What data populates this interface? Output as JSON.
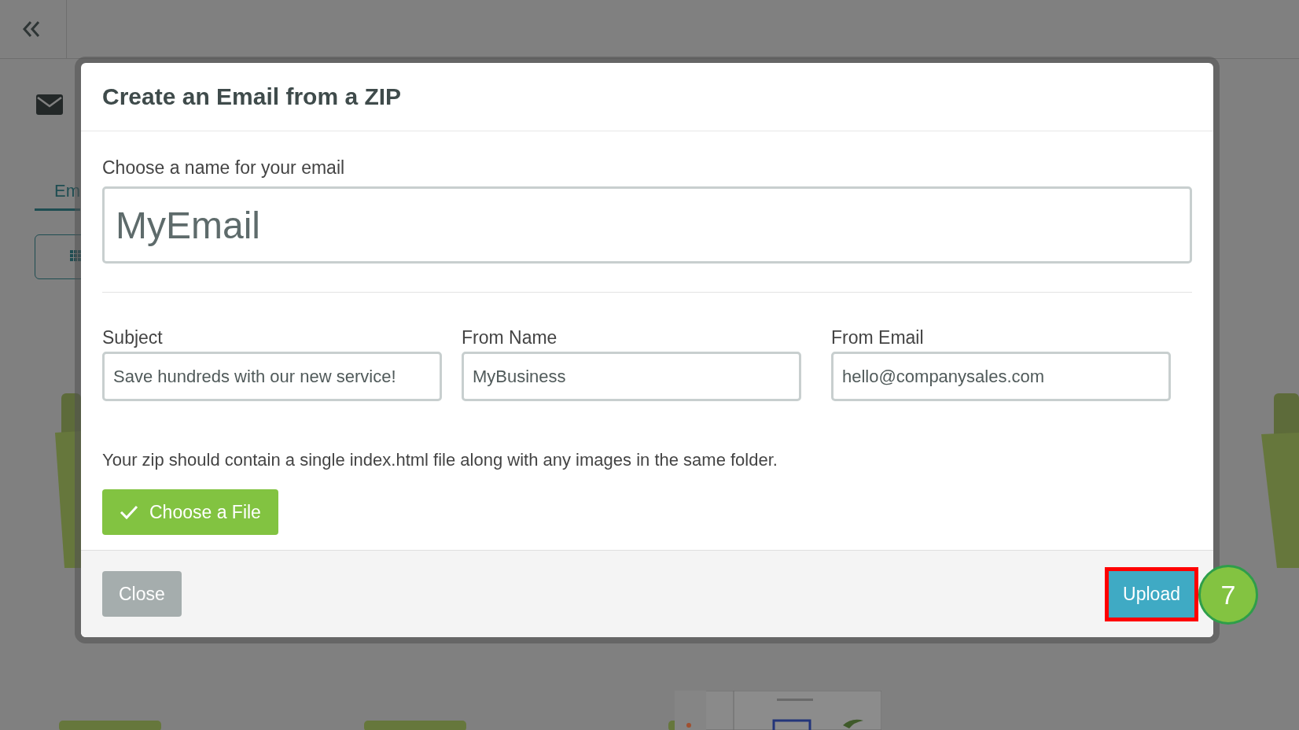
{
  "page": {
    "tab": {
      "label": "Em",
      "selected": true
    }
  },
  "dialog": {
    "title": "Create an Email from a ZIP",
    "name_field": {
      "label": "Choose a name for your email",
      "value": "MyEmail"
    },
    "fields": [
      {
        "label": "Subject",
        "value": "Save hundreds with our new service!"
      },
      {
        "label": "From Name",
        "value": "MyBusiness"
      },
      {
        "label": "From Email",
        "value": "hello@companysales.com"
      }
    ],
    "note": "Your zip should contain a single index.html file along with any images in the same folder.",
    "choose_button": {
      "label": "Choose a File",
      "checked": true
    },
    "close_button": {
      "label": "Close"
    },
    "upload_button": {
      "label": "Upload",
      "highlighted": true
    }
  },
  "step_badge": "7"
}
